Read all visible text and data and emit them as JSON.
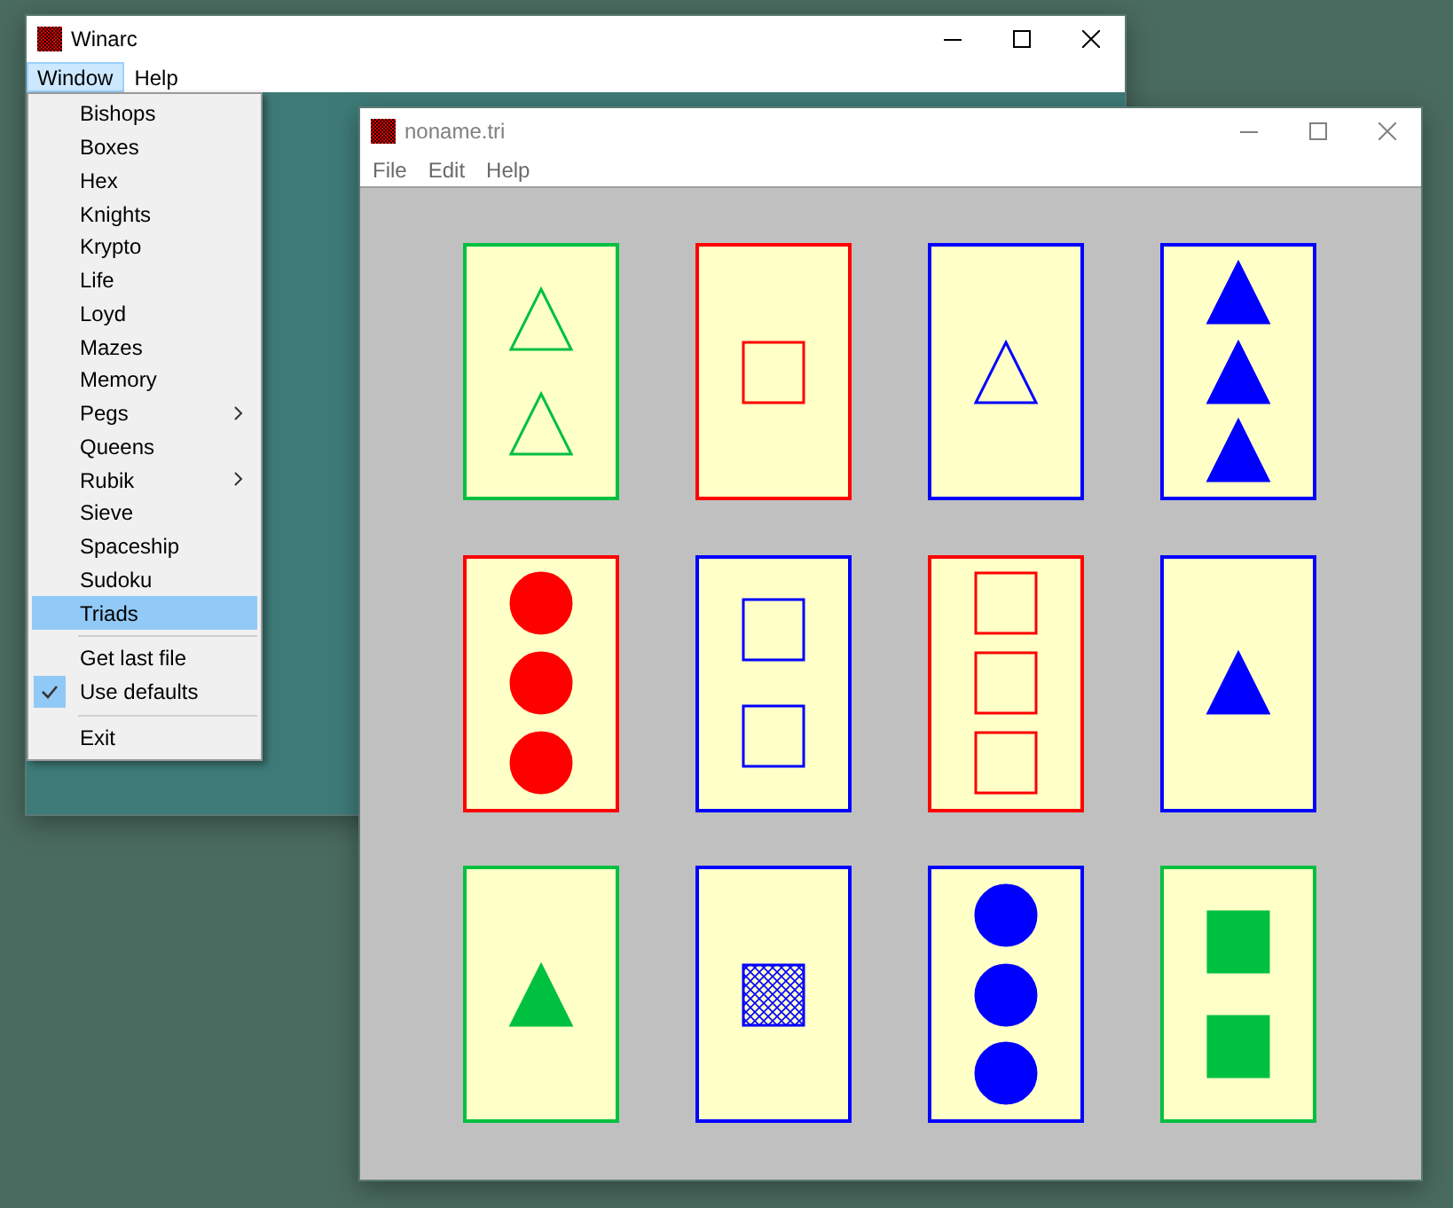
{
  "windows": [
    {
      "title": "Winarc",
      "active": true,
      "menu": [
        {
          "label": "Window",
          "selected": true
        },
        {
          "label": "Help",
          "selected": false
        }
      ]
    },
    {
      "title": "noname.tri",
      "active": false,
      "menu": [
        {
          "label": "File",
          "selected": false
        },
        {
          "label": "Edit",
          "selected": false
        },
        {
          "label": "Help",
          "selected": false
        }
      ]
    }
  ],
  "window_menu": {
    "groups": [
      [
        {
          "label": "Bishops",
          "selected": false,
          "checked": false,
          "submenu": false
        },
        {
          "label": "Boxes",
          "selected": false,
          "checked": false,
          "submenu": false
        },
        {
          "label": "Hex",
          "selected": false,
          "checked": false,
          "submenu": false
        },
        {
          "label": "Knights",
          "selected": false,
          "checked": false,
          "submenu": false
        },
        {
          "label": "Krypto",
          "selected": false,
          "checked": false,
          "submenu": false
        },
        {
          "label": "Life",
          "selected": false,
          "checked": false,
          "submenu": false
        },
        {
          "label": "Loyd",
          "selected": false,
          "checked": false,
          "submenu": false
        },
        {
          "label": "Mazes",
          "selected": false,
          "checked": false,
          "submenu": false
        },
        {
          "label": "Memory",
          "selected": false,
          "checked": false,
          "submenu": false
        },
        {
          "label": "Pegs",
          "selected": false,
          "checked": false,
          "submenu": true
        },
        {
          "label": "Queens",
          "selected": false,
          "checked": false,
          "submenu": false
        },
        {
          "label": "Rubik",
          "selected": false,
          "checked": false,
          "submenu": true
        },
        {
          "label": "Sieve",
          "selected": false,
          "checked": false,
          "submenu": false
        },
        {
          "label": "Spaceship",
          "selected": false,
          "checked": false,
          "submenu": false
        },
        {
          "label": "Sudoku",
          "selected": false,
          "checked": false,
          "submenu": false
        },
        {
          "label": "Triads",
          "selected": true,
          "checked": false,
          "submenu": false
        }
      ],
      [
        {
          "label": "Get last file",
          "selected": false,
          "checked": false,
          "submenu": false
        },
        {
          "label": "Use defaults",
          "selected": false,
          "checked": true,
          "submenu": false
        }
      ],
      [
        {
          "label": "Exit",
          "selected": false,
          "checked": false,
          "submenu": false
        }
      ]
    ]
  },
  "cards": [
    {
      "color": "#00c040",
      "kind": "outline",
      "symbols": [
        {
          "kind": "triangle"
        },
        {
          "kind": "triangle"
        }
      ]
    },
    {
      "color": "#ff0000",
      "kind": "outline",
      "symbols": [
        {
          "kind": "square"
        }
      ]
    },
    {
      "color": "#0000ff",
      "kind": "outline",
      "symbols": [
        {
          "kind": "triangle"
        }
      ]
    },
    {
      "color": "#0000ff",
      "kind": "solid",
      "symbols": [
        {
          "kind": "triangle"
        },
        {
          "kind": "triangle"
        },
        {
          "kind": "triangle"
        }
      ]
    },
    {
      "color": "#ff0000",
      "kind": "solid",
      "symbols": [
        {
          "kind": "circle"
        },
        {
          "kind": "circle"
        },
        {
          "kind": "circle"
        }
      ]
    },
    {
      "color": "#0000ff",
      "kind": "outline",
      "symbols": [
        {
          "kind": "square"
        },
        {
          "kind": "square"
        }
      ]
    },
    {
      "color": "#ff0000",
      "kind": "outline",
      "symbols": [
        {
          "kind": "square"
        },
        {
          "kind": "square"
        },
        {
          "kind": "square"
        }
      ]
    },
    {
      "color": "#0000ff",
      "kind": "solid",
      "symbols": [
        {
          "kind": "triangle"
        }
      ]
    },
    {
      "color": "#00c040",
      "kind": "solid",
      "symbols": [
        {
          "kind": "triangle"
        }
      ]
    },
    {
      "color": "#0000ff",
      "kind": "hatched",
      "symbols": [
        {
          "kind": "square"
        }
      ]
    },
    {
      "color": "#0000ff",
      "kind": "solid",
      "symbols": [
        {
          "kind": "circle"
        },
        {
          "kind": "circle"
        },
        {
          "kind": "circle"
        }
      ]
    },
    {
      "color": "#00c040",
      "kind": "solid",
      "symbols": [
        {
          "kind": "square"
        },
        {
          "kind": "square"
        }
      ]
    }
  ]
}
